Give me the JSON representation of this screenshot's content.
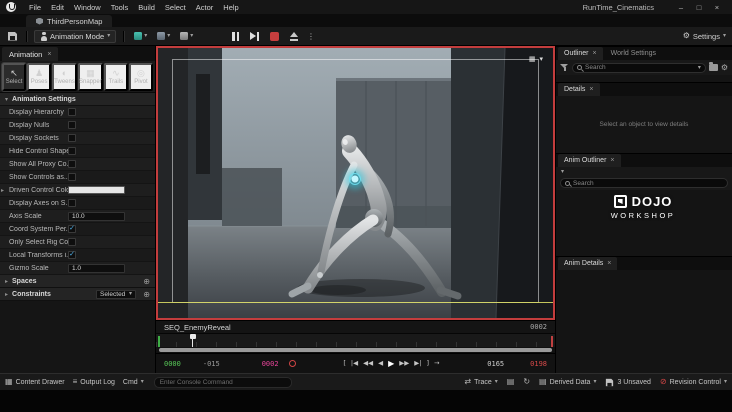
{
  "window": {
    "menus": [
      "File",
      "Edit",
      "Window",
      "Tools",
      "Build",
      "Select",
      "Actor",
      "Help"
    ],
    "project_title": "RunTime_Cinematics",
    "controls": {
      "minimize": "–",
      "maximize": "□",
      "close": "×"
    }
  },
  "level_tab": {
    "label": "ThirdPersonMap"
  },
  "toolbar": {
    "mode_label": "Animation Mode",
    "settings_label": "Settings"
  },
  "left_panel": {
    "tab": "Animation",
    "tools": [
      {
        "label": "Select",
        "icon": "↖"
      },
      {
        "label": "Poses",
        "icon": "♟"
      },
      {
        "label": "Tweens",
        "icon": "◐"
      },
      {
        "label": "Snapper",
        "icon": "▦"
      },
      {
        "label": "Trails",
        "icon": "∿"
      },
      {
        "label": "Pivot",
        "icon": "◎"
      }
    ],
    "settings_header": "Animation Settings",
    "rows": [
      {
        "label": "Display Hierarchy",
        "check": ""
      },
      {
        "label": "Display Nulls",
        "check": ""
      },
      {
        "label": "Display Sockets",
        "check": ""
      },
      {
        "label": "Hide Control Shapes",
        "check": ""
      },
      {
        "label": "Show All Proxy Co...",
        "check": ""
      },
      {
        "label": "Show Controls as...",
        "check": ""
      },
      {
        "label": "Driven Control Color",
        "color": "#e6e6e6"
      },
      {
        "label": "Display Axes on S...",
        "check": ""
      },
      {
        "label": "Axis Scale",
        "value": "10.0"
      },
      {
        "label": "Coord System Per...",
        "check": "✓"
      },
      {
        "label": "Only Select Rig Co...",
        "check": ""
      },
      {
        "label": "Local Transforms i...",
        "check": "✓"
      },
      {
        "label": "Gizmo Scale",
        "value": "1.0"
      }
    ],
    "spaces_header": "Spaces",
    "constraints_header": "Constraints",
    "constraints_value": "Selected"
  },
  "sequencer": {
    "name": "SEQ_EnemyReveal",
    "frame": "0002",
    "time_start": "0000",
    "time_offset": "-015",
    "time_current": "0002",
    "range_end": "0165",
    "range_total": "0198",
    "transport": [
      "[",
      "|◀",
      "◀◀",
      "◀",
      "▶",
      "▶▶",
      "▶|",
      "]",
      "→"
    ]
  },
  "right_panel": {
    "outliner_tab": "Outliner",
    "world_settings_tab": "World Settings",
    "search_placeholder": "Search",
    "details_tab": "Details",
    "details_empty": "Select an object to view details",
    "anim_outliner_tab": "Anim Outliner",
    "anim_details_tab": "Anim Details"
  },
  "status_bar": {
    "content_drawer": "Content Drawer",
    "output_log": "Output Log",
    "cmd": "Cmd",
    "console_placeholder": "Enter Console Command",
    "trace": "Trace",
    "derived_data": "Derived Data",
    "unsaved": "3 Unsaved",
    "revision_control": "Revision Control"
  },
  "watermark": {
    "title": "DOJO",
    "subtitle": "WORKSHOP"
  },
  "icons": {
    "close": "×",
    "caret_down": "▾",
    "caret_right": "▸",
    "plus_circle": "⊕",
    "kebab": "⋮",
    "gear": "⚙",
    "grid": "▦",
    "list": "≡",
    "rows": "▤",
    "trace": "⇄",
    "refresh": "↻",
    "no_entry": "⊘"
  },
  "colors": {
    "record_border": "#c33d3d",
    "accent_check": "#4fb0e8",
    "glow_cyan": "#7ae9f7",
    "time_start_green": "#58c858",
    "time_current_pink": "#e8449a",
    "total_red": "#d84a4a"
  }
}
